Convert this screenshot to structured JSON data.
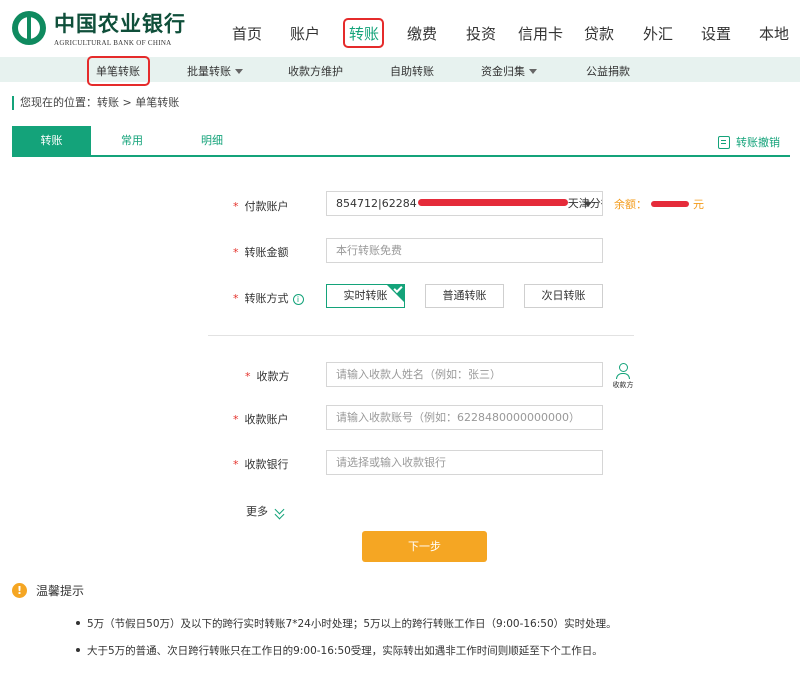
{
  "header": {
    "logo_cn": "中国农业银行",
    "logo_en": "AGRICULTURAL BANK OF CHINA",
    "nav": [
      "首页",
      "账户",
      "转账",
      "缴费",
      "投资",
      "信用卡",
      "贷款",
      "外汇",
      "设置",
      "本地"
    ],
    "active_nav": "转账"
  },
  "subnav": {
    "items": [
      {
        "label": "单笔转账",
        "has_dropdown": false
      },
      {
        "label": "批量转账",
        "has_dropdown": true
      },
      {
        "label": "收款方维护",
        "has_dropdown": false
      },
      {
        "label": "自助转账",
        "has_dropdown": false
      },
      {
        "label": "资金归集",
        "has_dropdown": true
      },
      {
        "label": "公益捐款",
        "has_dropdown": false
      }
    ]
  },
  "breadcrumb": "您现在的位置：转账 > 单笔转账",
  "tabs": {
    "items": [
      "转账",
      "常用",
      "明细"
    ],
    "active": "转账",
    "undo_label": "转账撤销"
  },
  "form": {
    "pay_account": {
      "label": "付款账户",
      "value_prefix": "854712|62284",
      "value_suffix": "天津分行"
    },
    "balance": {
      "label": "余额：",
      "unit": "元"
    },
    "amount": {
      "label": "转账金额",
      "placeholder": "本行转账免费"
    },
    "mode": {
      "label": "转账方式",
      "info_glyph": "i",
      "options": [
        "实时转账",
        "普通转账",
        "次日转账"
      ],
      "selected": "实时转账"
    },
    "payee": {
      "label": "收款方",
      "placeholder": "请输入收款人姓名（例如：张三）",
      "icon_label": "收款方"
    },
    "payee_account": {
      "label": "收款账户",
      "placeholder": "请输入收款账号（例如：6228480000000000）"
    },
    "payee_bank": {
      "label": "收款银行",
      "placeholder": "请选择或输入收款银行"
    },
    "more_label": "更多",
    "next_label": "下一步",
    "required_mark": "*"
  },
  "tips": {
    "title": "温馨提示",
    "icon_glyph": "!",
    "lines": [
      "5万（节假日50万）及以下的跨行实时转账7*24小时处理；5万以上的跨行转账工作日（9:00-16:50）实时处理。",
      "大于5万的普通、次日跨行转账只在工作日的9:00-16:50受理，实际转出如遇非工作时间则顺延至下个工作日。"
    ]
  },
  "colors": {
    "brand_green": "#14a37a",
    "accent_orange": "#f5a623",
    "highlight_red": "#e52b2b",
    "subnav_bg": "#e7f2ef"
  }
}
